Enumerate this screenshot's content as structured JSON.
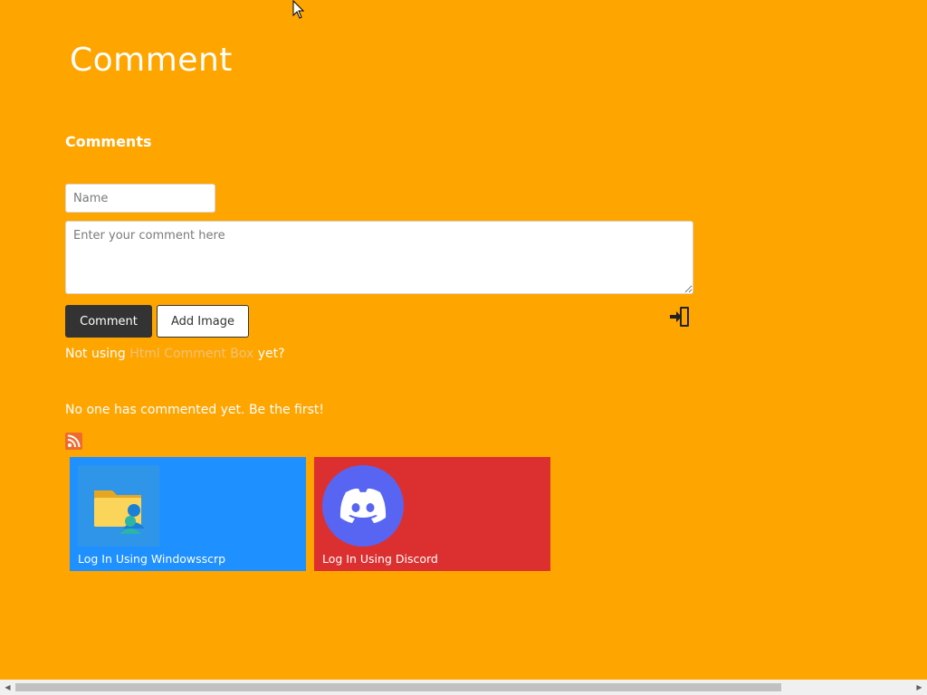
{
  "page": {
    "title": "Comment"
  },
  "comments": {
    "heading": "Comments",
    "name_placeholder": "Name",
    "comment_placeholder": "Enter your comment here",
    "comment_button": "Comment",
    "add_image_button": "Add Image",
    "promo_prefix": "Not using ",
    "promo_link": "Html Comment Box",
    "promo_suffix": " yet?",
    "empty_message": "No one has commented yet. Be the first!"
  },
  "login": {
    "windows_label": "Log In Using Windowsscrp",
    "discord_label": "Log In Using Discord"
  },
  "colors": {
    "background": "#FFA500",
    "windows_tile": "#1E90FF",
    "discord_tile": "#DC3030",
    "discord_brand": "#5865F2",
    "rss": "#EE6B2F"
  },
  "icons": {
    "login": "sign-in-icon",
    "rss": "rss-icon",
    "windows_logo": "folder-user-icon",
    "discord_logo": "discord-icon",
    "cursor": "mouse-cursor-icon"
  },
  "scrollbar": {
    "left_arrow": "◀",
    "right_arrow": "▶"
  }
}
